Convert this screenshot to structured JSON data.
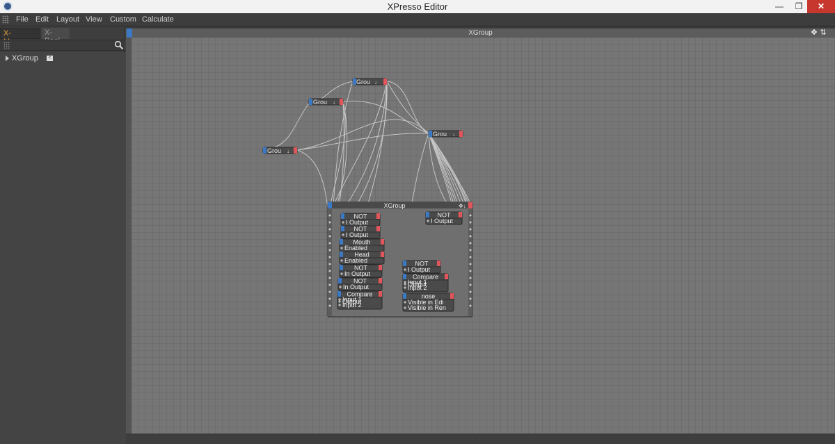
{
  "window": {
    "title": "XPresso Editor"
  },
  "menu": [
    "File",
    "Edit",
    "Layout",
    "View",
    "Custom",
    "Calculate"
  ],
  "left_panel": {
    "tabs": [
      {
        "label": "X-Manager",
        "active": true
      },
      {
        "label": "X-Pool",
        "active": false
      }
    ],
    "tree": [
      {
        "label": "XGroup",
        "flag": "<"
      }
    ]
  },
  "editor": {
    "header_title": "XGroup",
    "collapsed_groups": [
      {
        "label": "Grou"
      },
      {
        "label": "Grou"
      },
      {
        "label": "Grou"
      },
      {
        "label": "Grou"
      }
    ],
    "xgroup": {
      "title": "XGroup",
      "nodes": [
        {
          "name": "NOT",
          "ports": [
            "I Output"
          ]
        },
        {
          "name": "NOT",
          "ports": [
            "I Output"
          ]
        },
        {
          "name": "Mouth",
          "ports": [
            "Enabled"
          ]
        },
        {
          "name": "Head",
          "ports": [
            "Enabled"
          ]
        },
        {
          "name": "NOT",
          "ports": [
            "In Output"
          ]
        },
        {
          "name": "NOT",
          "ports": [
            "In Output"
          ]
        },
        {
          "name": "Compare",
          "ports": [
            "Input 1",
            "Output",
            "Input 2"
          ]
        },
        {
          "name": "NOT",
          "ports": [
            "I Output"
          ]
        },
        {
          "name": "NOT",
          "ports": [
            "I Output"
          ]
        },
        {
          "name": "Compare",
          "ports": [
            "Input 1",
            "Output",
            "Input 2"
          ]
        },
        {
          "name": "nose",
          "ports": [
            "Visible in Edi",
            "Visible in Ren"
          ]
        }
      ]
    }
  },
  "colors": {
    "port_in": "#3c79c4",
    "port_out": "#e0565a",
    "node_body": "#4a4a4a",
    "canvas": "#767676",
    "active_tab": "#e8a33b"
  }
}
